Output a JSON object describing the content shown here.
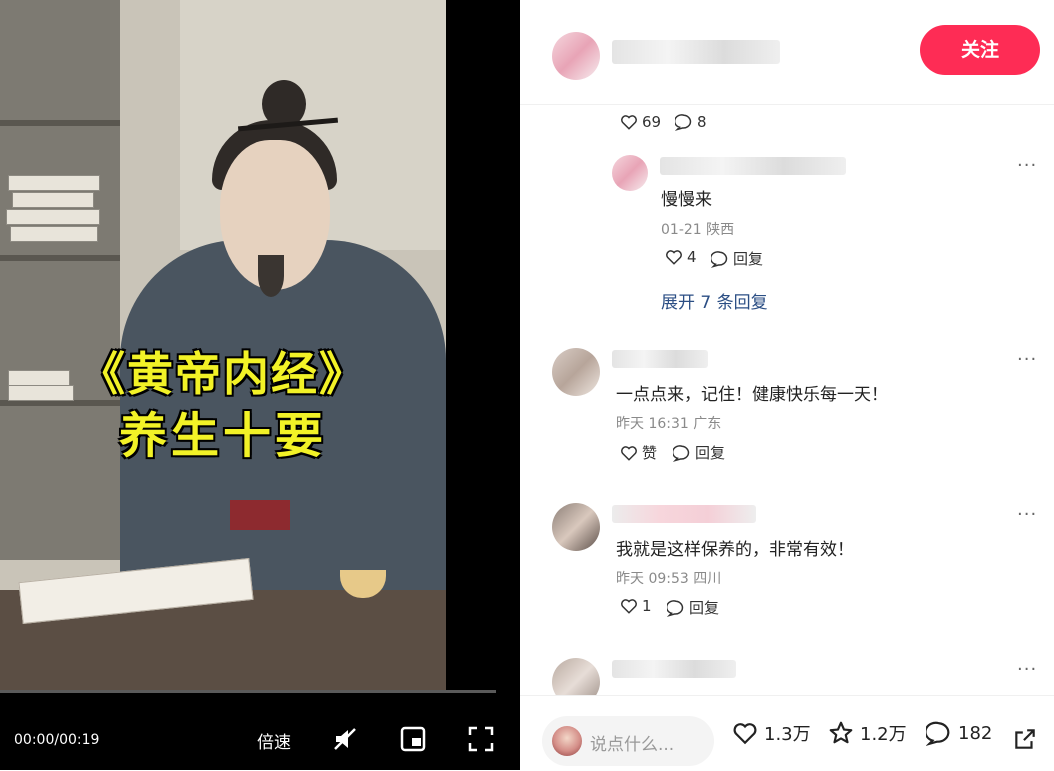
{
  "video": {
    "title_line1": "《黄帝内经》",
    "title_line2": "养生十要",
    "time": "00:00/00:19",
    "speed_label": "倍速",
    "progress": 0.0
  },
  "header": {
    "follow_label": "关注"
  },
  "comments": [
    {
      "likes": "69",
      "replies": "8"
    },
    {
      "text": "慢慢来",
      "meta": "01-21 陕西",
      "likes": "4",
      "reply_label": "回复",
      "expand_label": "展开 7 条回复"
    },
    {
      "text": "一点点来，记住！健康快乐每一天！",
      "meta": "昨天 16:31 广东",
      "like_label": "赞",
      "reply_label": "回复"
    },
    {
      "text": "我就是这样保养的，非常有效！",
      "meta": "昨天 09:53 四川",
      "likes": "1",
      "reply_label": "回复"
    }
  ],
  "footer": {
    "input_placeholder": "说点什么...",
    "likes": "1.3万",
    "favorites": "1.2万",
    "comments": "182"
  },
  "colors": {
    "accent": "#fe2c55",
    "link": "#2b4e84",
    "title_yellow": "#f2f227"
  },
  "icons": [
    "heart-icon",
    "comment-icon",
    "star-icon",
    "share-icon",
    "mute-icon",
    "pip-icon",
    "fullscreen-icon"
  ]
}
